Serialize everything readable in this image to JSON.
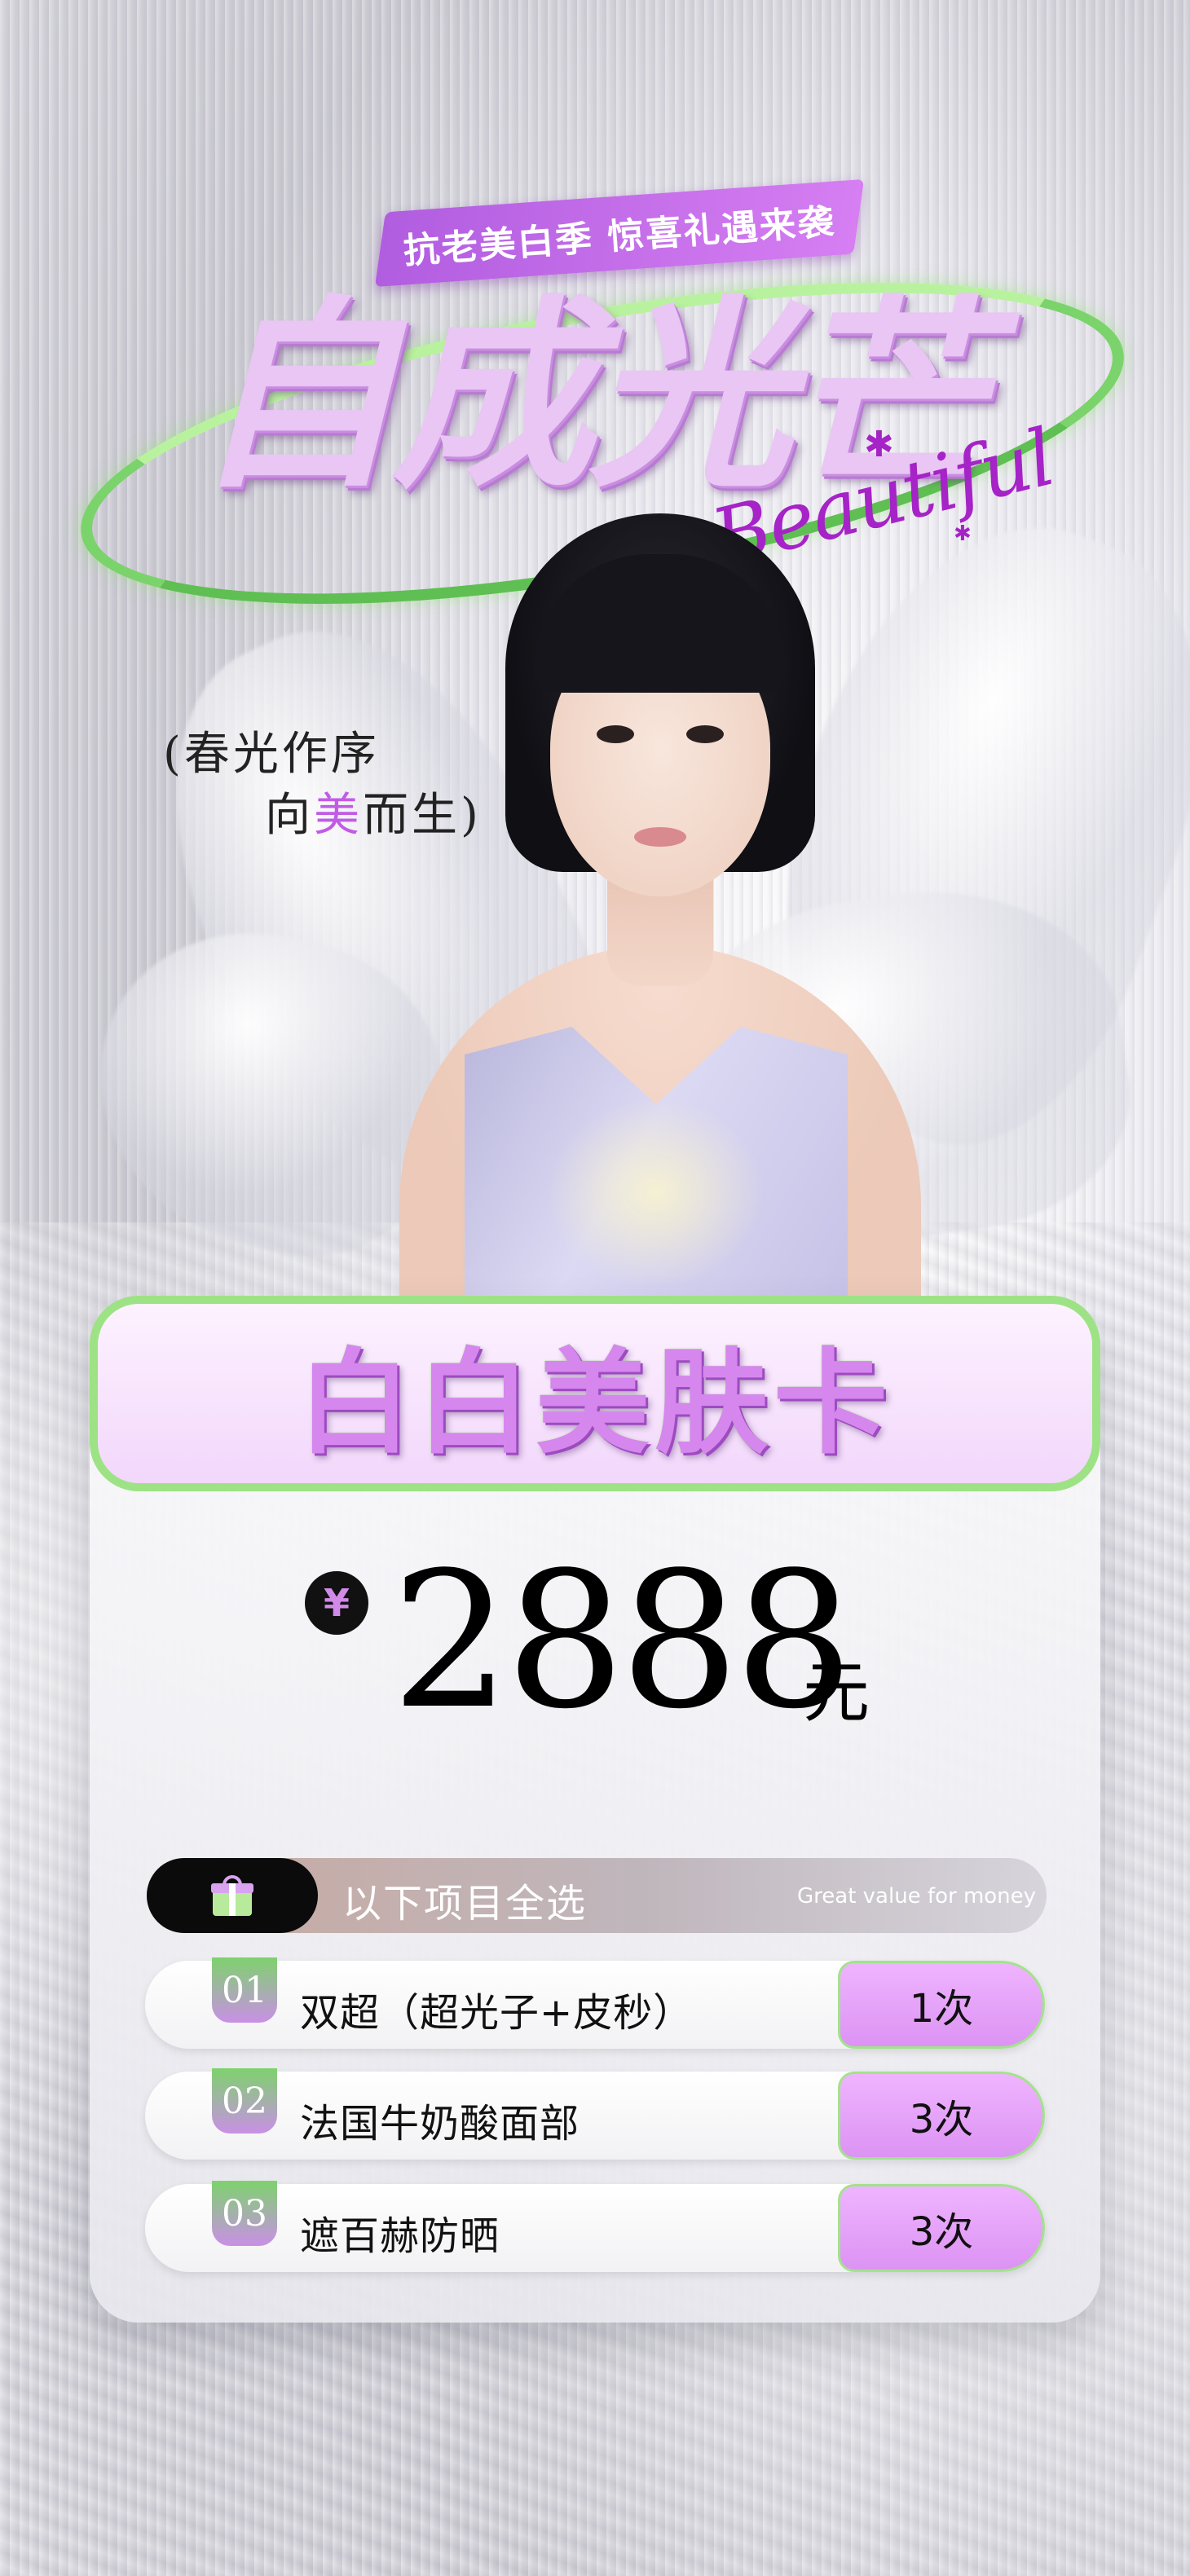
{
  "header": {
    "banner_text": "抗老美白季 惊喜礼遇来袭",
    "main_title": "自成光芒",
    "script_text": "Beautiful"
  },
  "slogan": {
    "line1": "春光作序",
    "line2_prefix": "向",
    "line2_accent": "美",
    "line2_suffix": "而生"
  },
  "card": {
    "title": "白白美肤卡",
    "currency_symbol": "¥",
    "price": "2888",
    "price_unit": "元"
  },
  "selection": {
    "icon": "gift-icon",
    "label": "以下项目全选",
    "subtitle": "Great value for money"
  },
  "items": [
    {
      "num": "01",
      "name": "双超（超光子+皮秒）",
      "count": "1次"
    },
    {
      "num": "02",
      "name": "法国牛奶酸面部",
      "count": "3次"
    },
    {
      "num": "03",
      "name": "遮百赫防晒",
      "count": "3次"
    }
  ],
  "colors": {
    "accent_purple": "#d587ee",
    "accent_green": "#9ee286",
    "dark": "#0b0b0b"
  }
}
